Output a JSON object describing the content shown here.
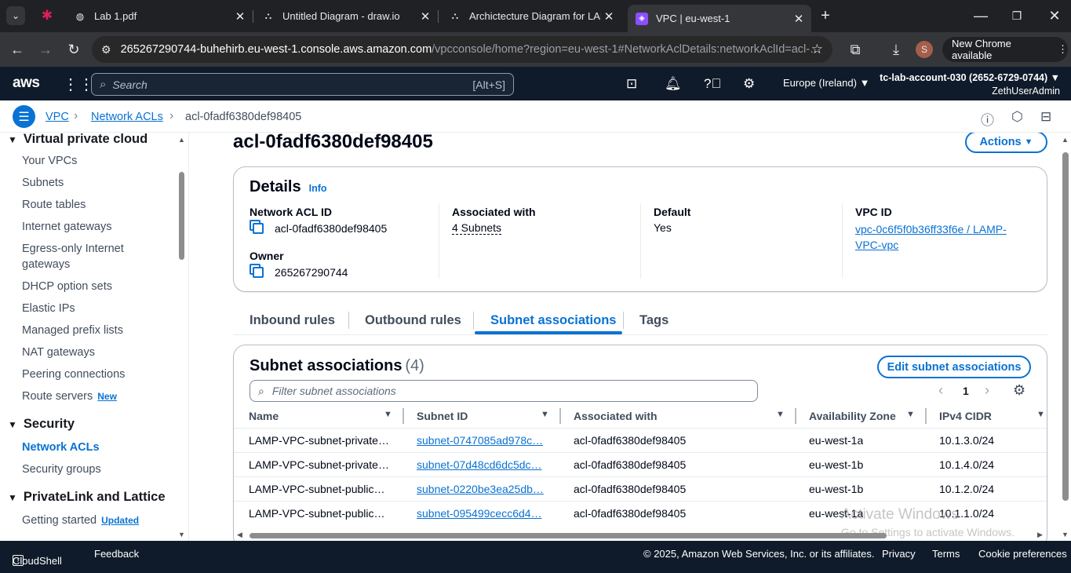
{
  "browser": {
    "tabs": [
      {
        "title": "Lab 1.pdf",
        "icon": "globe-icon"
      },
      {
        "title": "Untitled Diagram - draw.io",
        "icon": "drawio-icon"
      },
      {
        "title": "Archictecture Diagram for LAMP",
        "icon": "drawio-icon"
      },
      {
        "title": "VPC | eu-west-1",
        "icon": "aws-icon"
      }
    ],
    "url_host": "265267290744-buhehirb.eu-west-1.console.aws.amazon.com",
    "url_rest": "/vpcconsole/home?region=eu-west-1#NetworkAclDetails:networkAclId=acl-…",
    "profile_initial": "S",
    "new_chrome_label": "New Chrome available"
  },
  "aws_nav": {
    "logo": "aws",
    "search_placeholder": "Search",
    "search_shortcut": "[Alt+S]",
    "region": "Europe (Ireland)",
    "account": "tc-lab-account-030 (2652-6729-0744)",
    "user": "ZethUserAdmin"
  },
  "breadcrumb": [
    "VPC",
    "Network ACLs",
    "acl-0fadf6380def98405"
  ],
  "sidebar": {
    "section_vpc": "Virtual private cloud",
    "vpc_items": [
      "Your VPCs",
      "Subnets",
      "Route tables",
      "Internet gateways",
      "Egress-only Internet gateways",
      "DHCP option sets",
      "Elastic IPs",
      "Managed prefix lists",
      "NAT gateways",
      "Peering connections",
      "Route servers"
    ],
    "route_servers_badge": "New",
    "section_security": "Security",
    "security_items": [
      "Network ACLs",
      "Security groups"
    ],
    "section_privatelink": "PrivateLink and Lattice",
    "privatelink_items": [
      "Getting started"
    ],
    "getting_started_badge": "Updated"
  },
  "page": {
    "title": "acl-0fadf6380def98405",
    "actions_label": "Actions"
  },
  "details": {
    "heading": "Details",
    "info": "Info",
    "network_acl_id_label": "Network ACL ID",
    "network_acl_id": "acl-0fadf6380def98405",
    "owner_label": "Owner",
    "owner": "265267290744",
    "associated_label": "Associated with",
    "associated": "4 Subnets",
    "default_label": "Default",
    "default": "Yes",
    "vpc_id_label": "VPC ID",
    "vpc_id": "vpc-0c6f5f0b36ff33f6e / LAMP-VPC-vpc"
  },
  "tabs": [
    "Inbound rules",
    "Outbound rules",
    "Subnet associations",
    "Tags"
  ],
  "subnets": {
    "heading": "Subnet associations",
    "count": "(4)",
    "edit_label": "Edit subnet associations",
    "filter_placeholder": "Filter subnet associations",
    "page": "1",
    "columns": [
      "Name",
      "Subnet ID",
      "Associated with",
      "Availability Zone",
      "IPv4 CIDR"
    ],
    "rows": [
      {
        "name": "LAMP-VPC-subnet-private…",
        "subnet_id": "subnet-0747085ad978c…",
        "assoc": "acl-0fadf6380def98405",
        "az": "eu-west-1a",
        "cidr": "10.1.3.0/24"
      },
      {
        "name": "LAMP-VPC-subnet-private…",
        "subnet_id": "subnet-07d48cd6dc5dc…",
        "assoc": "acl-0fadf6380def98405",
        "az": "eu-west-1b",
        "cidr": "10.1.4.0/24"
      },
      {
        "name": "LAMP-VPC-subnet-public…",
        "subnet_id": "subnet-0220be3ea25db…",
        "assoc": "acl-0fadf6380def98405",
        "az": "eu-west-1b",
        "cidr": "10.1.2.0/24"
      },
      {
        "name": "LAMP-VPC-subnet-public…",
        "subnet_id": "subnet-095499cecc6d4…",
        "assoc": "acl-0fadf6380def98405",
        "az": "eu-west-1a",
        "cidr": "10.1.1.0/24"
      }
    ]
  },
  "footer": {
    "cloudshell": "CloudShell",
    "feedback": "Feedback",
    "copyright": "© 2025, Amazon Web Services, Inc. or its affiliates.",
    "privacy": "Privacy",
    "terms": "Terms",
    "cookies": "Cookie preferences"
  },
  "watermark": {
    "title": "Activate Windows",
    "sub": "Go to Settings to activate Windows."
  },
  "colors": {
    "accent": "#0972d3",
    "nav_bg": "#0f1b2a",
    "chrome_bg": "#202124"
  }
}
